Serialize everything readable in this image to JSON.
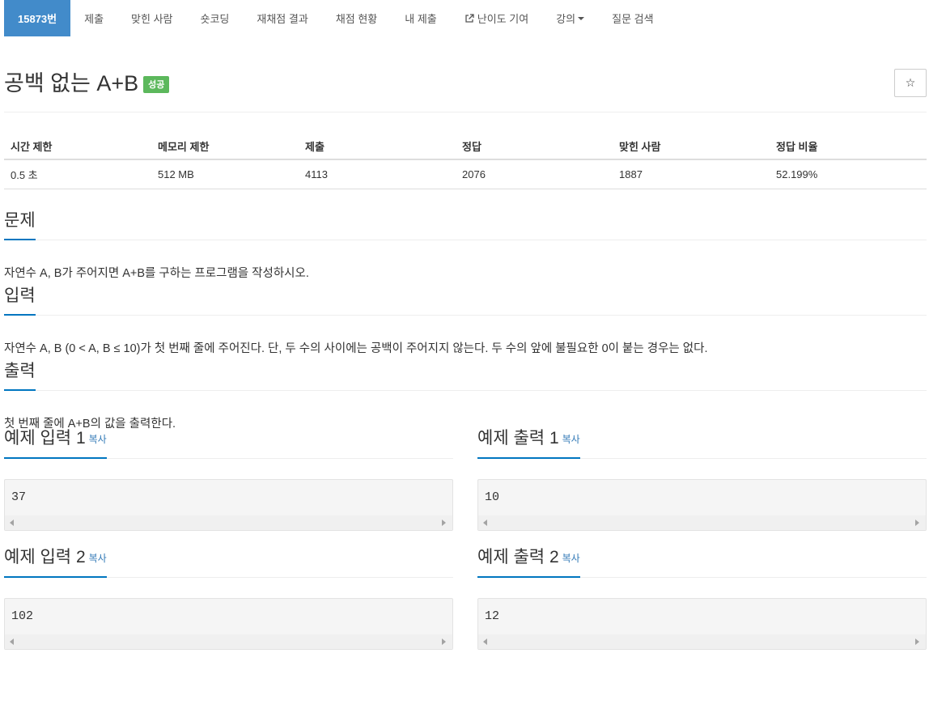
{
  "nav": {
    "items": [
      {
        "label": "15873번",
        "active": true
      },
      {
        "label": "제출"
      },
      {
        "label": "맞힌 사람"
      },
      {
        "label": "숏코딩"
      },
      {
        "label": "재채점 결과"
      },
      {
        "label": "채점 현황"
      },
      {
        "label": "내 제출"
      },
      {
        "label": "난이도 기여",
        "icon": "external-link-icon"
      },
      {
        "label": "강의",
        "dropdown": true
      },
      {
        "label": "질문 검색"
      }
    ]
  },
  "problem": {
    "title": "공백 없는 A+B",
    "status_badge": "성공",
    "star_icon": "☆"
  },
  "info_table": {
    "headers": [
      "시간 제한",
      "메모리 제한",
      "제출",
      "정답",
      "맞힌 사람",
      "정답 비율"
    ],
    "values": [
      "0.5 초",
      "512 MB",
      "4113",
      "2076",
      "1887",
      "52.199%"
    ]
  },
  "sections": {
    "description": {
      "heading": "문제",
      "body": "자연수 A, B가 주어지면 A+B를 구하는 프로그램을 작성하시오."
    },
    "input": {
      "heading": "입력",
      "body": "자연수 A, B (0 < A, B ≤ 10)가 첫 번째 줄에 주어진다. 단, 두 수의 사이에는 공백이 주어지지 않는다. 두 수의 앞에 불필요한 0이 붙는 경우는 없다."
    },
    "output": {
      "heading": "출력",
      "body": "첫 번째 줄에 A+B의 값을 출력한다."
    }
  },
  "samples": {
    "copy_label": "복사",
    "rows": [
      {
        "input_heading": "예제 입력 1",
        "input_value": "37",
        "output_heading": "예제 출력 1",
        "output_value": "10"
      },
      {
        "input_heading": "예제 입력 2",
        "input_value": "102",
        "output_heading": "예제 출력 2",
        "output_value": "12"
      }
    ]
  },
  "colors": {
    "active_tab": "#428bca",
    "success_badge": "#5cb85c",
    "section_underline": "#0076c0",
    "link": "#337ab7"
  }
}
